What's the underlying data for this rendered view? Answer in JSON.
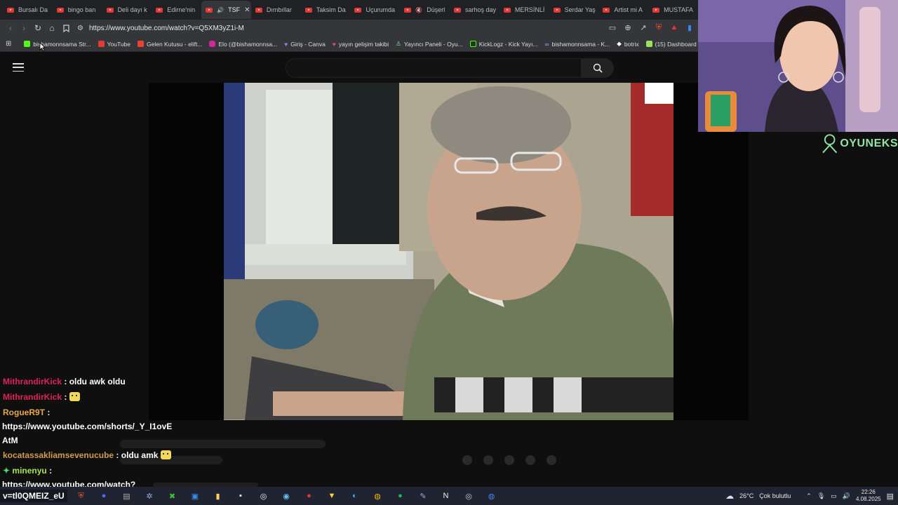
{
  "tabs": [
    {
      "label": "Bursalı Da"
    },
    {
      "label": "bingo ban"
    },
    {
      "label": "Deli dayı k"
    },
    {
      "label": "Edirne'nin"
    },
    {
      "label": "TSF",
      "active": true
    },
    {
      "label": "Dımbıllar"
    },
    {
      "label": "Taksim Da"
    },
    {
      "label": "Uçurumda"
    },
    {
      "label": "Düşerl"
    },
    {
      "label": "sarhoş day"
    },
    {
      "label": "MERSİNLİ"
    },
    {
      "label": "Serdar Yaş"
    },
    {
      "label": "Artist mi A"
    },
    {
      "label": "MUSTAFA"
    }
  ],
  "address": {
    "url": "https://www.youtube.com/watch?v=Q5XM3yZ1i-M"
  },
  "bookmarks": [
    {
      "label": "bishamonnsama Str...",
      "icon": "kick-icon",
      "color": "#53fc18"
    },
    {
      "label": "YouTube",
      "icon": "youtube-icon",
      "color": "#e53935"
    },
    {
      "label": "Gelen Kutusu - elift...",
      "icon": "gmail-icon",
      "color": "#ea4335"
    },
    {
      "label": "Elo (@bishamonnsa...",
      "icon": "instagram-icon",
      "color": "#d6249f"
    },
    {
      "label": "Giriş - Canva",
      "icon": "heart-icon",
      "color": "#7b8cff"
    },
    {
      "label": "yayın gelişim takibi",
      "icon": "heart-icon",
      "color": "#e8457a"
    },
    {
      "label": "Yayıncı Paneli - Oyu...",
      "icon": "person-icon",
      "color": "#8fe4a2"
    },
    {
      "label": "KickLogz - Kick Yayı...",
      "icon": "kicklogz-icon",
      "color": "#53fc18"
    },
    {
      "label": "bishamonnsama - K...",
      "icon": "link-icon",
      "color": "#9aa7ff"
    },
    {
      "label": "botrix",
      "icon": "diamond-icon",
      "color": "#ffffff"
    },
    {
      "label": "(15) Dashboard",
      "icon": "dashboard-icon",
      "color": "#9be15d"
    }
  ],
  "chat": {
    "messages": [
      {
        "user": "MithrandirKick",
        "text": "oldu awk oldu"
      },
      {
        "user": "MithrandirKick",
        "text": "",
        "emote": true
      },
      {
        "user": "RogueR9T",
        "text": "https://www.youtube.com/shorts/_Y_I1ovE",
        "text2": "AtM"
      },
      {
        "user": "kocatassakliamsevenucube",
        "text": "oldu amk",
        "emote": true
      },
      {
        "user": "minenyu",
        "text": "https://www.youtube.com/watch?"
      }
    ],
    "separator": " : "
  },
  "logo": {
    "text": "OYUNEKS"
  },
  "overlay": {
    "label": "v=tl0QMEIZ_eU"
  },
  "tray": {
    "weather_temp": "26°C",
    "weather_text": "Çok bulutlu",
    "time": "22:26",
    "date": "4.08.2025"
  },
  "colors": {
    "chat_user_red": "#e0215a",
    "chat_user_orange": "#e7a74a",
    "chat_user_green": "#a7e34a",
    "logo_green": "#8fe4a2"
  }
}
